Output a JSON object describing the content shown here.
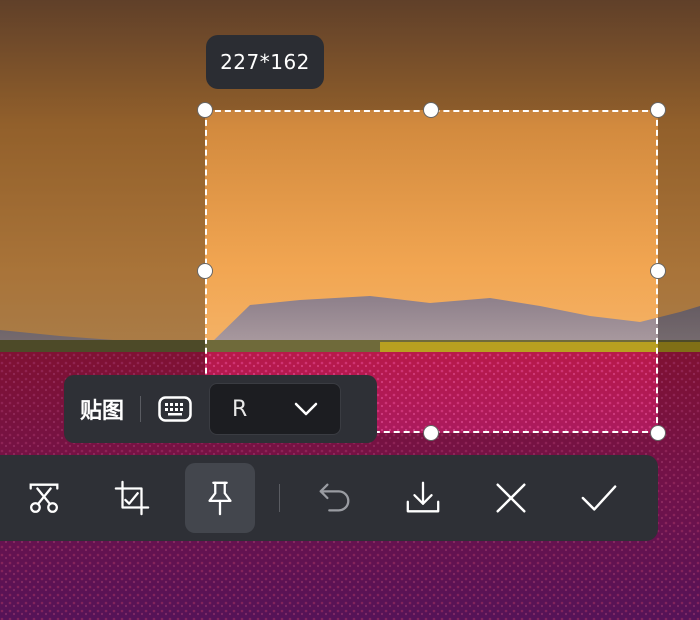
{
  "capture": {
    "size_label": "227*162"
  },
  "pin_panel": {
    "label": "贴图",
    "shortcut_value": "R"
  },
  "toolbar": {
    "tools": [
      {
        "icon": "scissors-icon"
      },
      {
        "icon": "crop-check-icon"
      },
      {
        "icon": "pin-icon",
        "active": true
      },
      {
        "icon": "undo-icon"
      },
      {
        "icon": "download-icon"
      },
      {
        "icon": "close-icon"
      },
      {
        "icon": "check-icon"
      }
    ]
  },
  "colors": {
    "toolbar_bg": "#2e3036",
    "tooltip_bg": "#2b2d33",
    "active_tool_bg": "#43464d",
    "icon_color": "#ffffff"
  }
}
